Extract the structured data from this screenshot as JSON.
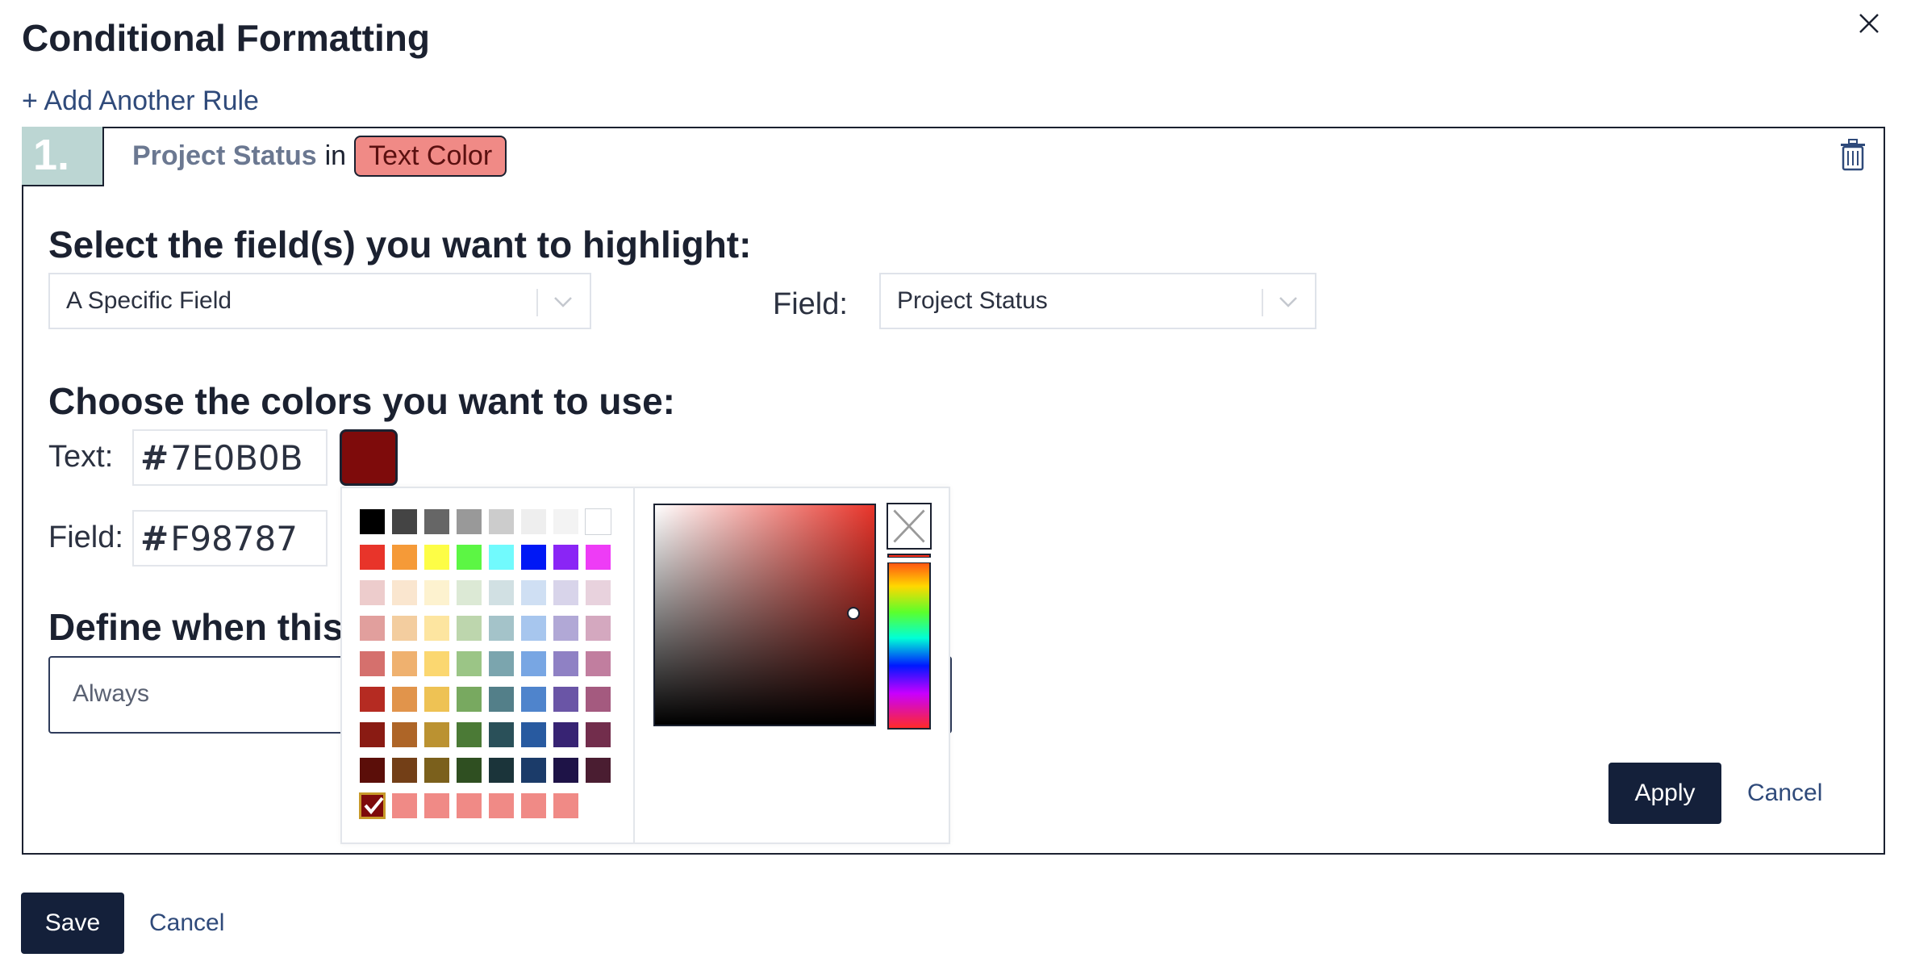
{
  "dialog": {
    "title": "Conditional Formatting"
  },
  "add_rule_label": "+ Add Another Rule",
  "rule": {
    "number": "1.",
    "field_name": "Project Status",
    "connector": "in",
    "tag_label": "Text Color",
    "section_fields_title": "Select the field(s) you want to highlight:",
    "scope_select_value": "A Specific Field",
    "field_label": "Field:",
    "field_select_value": "Project Status",
    "section_colors_title": "Choose the colors you want to use:",
    "text_label": "Text:",
    "text_hex": "7E0B0B",
    "field_color_label": "Field:",
    "field_hex": "F98787",
    "section_when_title": "Define when this",
    "when_value": "Always",
    "apply_label": "Apply",
    "cancel_label": "Cancel"
  },
  "footer": {
    "save_label": "Save",
    "cancel_label": "Cancel"
  },
  "color_picker": {
    "palette": [
      [
        "#000000",
        "#444444",
        "#666666",
        "#999999",
        "#cccccc",
        "#eeeeee",
        "#f3f3f3",
        "#ffffff"
      ],
      [
        "#e8342a",
        "#f59a38",
        "#fdfd46",
        "#5cf644",
        "#71fafd",
        "#0018f5",
        "#8a25f5",
        "#ee3cf6"
      ],
      [
        "#edcccc",
        "#fae6cf",
        "#fdf2cf",
        "#dce9d5",
        "#d1e0e3",
        "#cfdff3",
        "#d8d4ea",
        "#e8d2dd"
      ],
      [
        "#e19f9d",
        "#f3cd9f",
        "#fde5a0",
        "#bdd6ad",
        "#a4c3c9",
        "#a7c6ee",
        "#b1a8d6",
        "#d4a8bf"
      ],
      [
        "#d5706d",
        "#efb16f",
        "#fbd770",
        "#9bc586",
        "#7ba5ae",
        "#78a6e3",
        "#8f81c4",
        "#c17e9f"
      ],
      [
        "#b52b22",
        "#e1944b",
        "#eec254",
        "#78a960",
        "#537f89",
        "#4f84cc",
        "#6a55a6",
        "#a45a7f"
      ],
      [
        "#8a1b13",
        "#ae6527",
        "#bb9231",
        "#4b7a36",
        "#2a5059",
        "#285aa0",
        "#372373",
        "#722d4c"
      ],
      [
        "#5b0e09",
        "#733f17",
        "#7b601c",
        "#2f4f21",
        "#1b343a",
        "#1b3b69",
        "#1e1347",
        "#4a1d31"
      ]
    ],
    "custom_colors": [
      "#7e0b0b",
      "#f08a86",
      "#f08a86",
      "#f08a86",
      "#f08a86",
      "#f08a86",
      "#f08a86"
    ],
    "selected_color": "#7e0b0b",
    "current_hue_color": "#e8342a"
  }
}
